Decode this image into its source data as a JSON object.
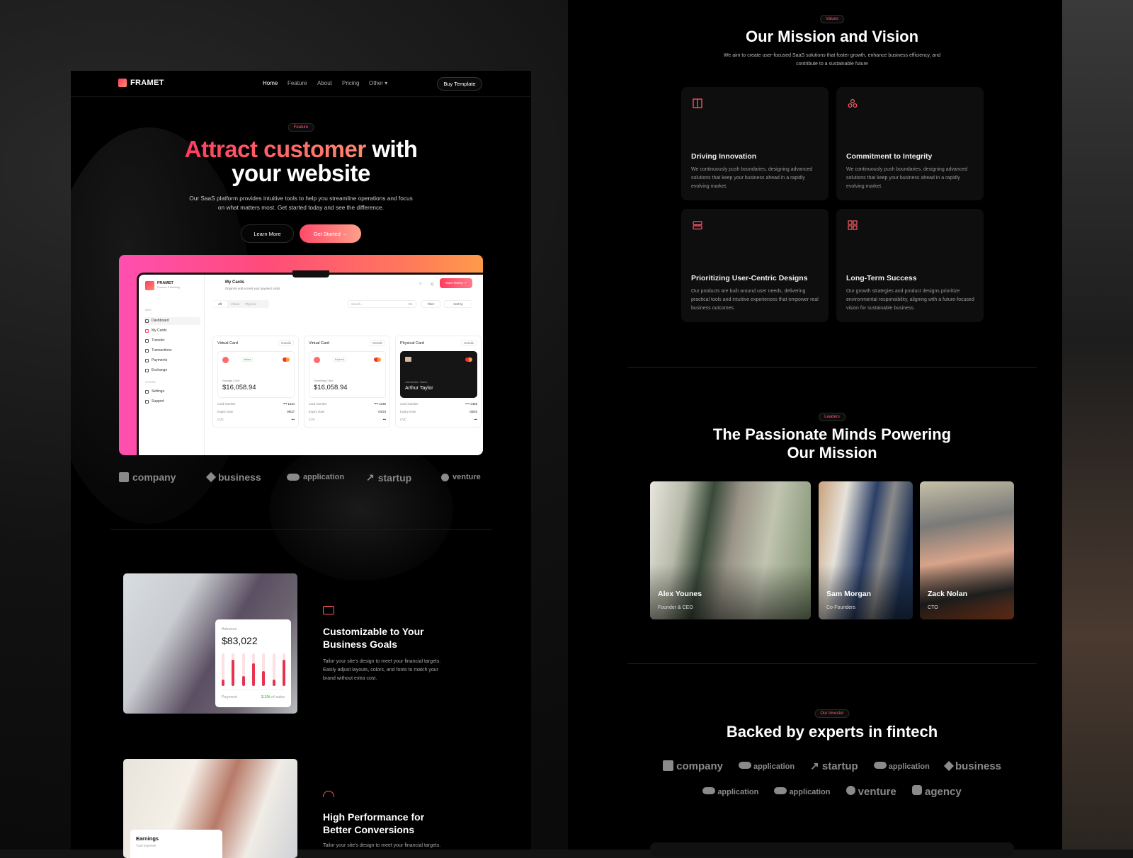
{
  "left": {
    "brand": "FRAMET",
    "nav": [
      "Home",
      "Feature",
      "About",
      "Pricing",
      "Other"
    ],
    "buy_button": "Buy Template",
    "hero": {
      "badge": "Feature",
      "title_highlight": "Attract customer",
      "title_rest1": "with",
      "title_line2": "your website",
      "subtitle_line1": "Our SaaS platform provides intuitive tools to help you streamline operations and focus",
      "subtitle_line2": "on what matters most. Get started today and see the difference.",
      "learn_more": "Learn More",
      "get_started": "Get Started →"
    },
    "dashboard": {
      "brand": "FRAMET",
      "brand_sub": "Finance & Banking",
      "section_main": "MAIN",
      "section_others": "OTHERS",
      "menu": [
        "Dashboard",
        "My Cards",
        "Transfer",
        "Transactions",
        "Payments",
        "Exchange"
      ],
      "menu_others": [
        "Settings",
        "Support"
      ],
      "page_title": "My Cards",
      "page_sub": "Organize and access your payment cards.",
      "move_money": "Move Money ↗",
      "tabs": [
        "All",
        "Virtual",
        "Physical"
      ],
      "search_placeholder": "Search...",
      "search_shortcut": "⌘1",
      "filter": "Filter",
      "sort": "Sort by",
      "cards": [
        {
          "type": "Virtual Card",
          "details": "Details",
          "status": "Active",
          "label": "Savings Card",
          "amount": "$16,058.94",
          "number": "•••• 1234",
          "expiry": "06/27",
          "cvc": "•••"
        },
        {
          "type": "Virtual Card",
          "details": "Details",
          "status": "Expired",
          "label": "Travelling Card",
          "amount": "$16,058.94",
          "number": "•••• 2345",
          "expiry": "04/23",
          "cvc": "•••"
        },
        {
          "type": "Physical Card",
          "details": "Details",
          "holder_label": "Cardholder Name",
          "holder": "Arthur Taylor",
          "number": "•••• 3456",
          "expiry": "08/20",
          "cvc": "•••"
        }
      ],
      "row_labels": {
        "number": "Card Number",
        "expiry": "Expiry Date",
        "cvc": "CVC"
      }
    },
    "logos": [
      "company",
      "business",
      "application",
      "startup",
      "venture"
    ],
    "features": [
      {
        "title_line1": "Customizable to Your",
        "title_line2": "Business Goals",
        "desc": [
          "Tailor your site's design to meet your financial targets.",
          "Easily adjust layouts, colors, and fonts to match your",
          "brand without extra cost."
        ],
        "widget": {
          "label": "Advance",
          "amount": "$83,022",
          "bars": [
            0.2,
            0.8,
            0.3,
            0.7,
            0.45,
            0.2,
            0.8
          ],
          "footer_label": "Payment",
          "pct": "2.1%",
          "pct_suffix": "of sales"
        }
      },
      {
        "title_line1": "High Performance for",
        "title_line2": "Better Conversions",
        "desc": [
          "Tailor your site's design to meet your financial targets."
        ],
        "widget": {
          "title": "Earnings",
          "sub": "Total Expense"
        }
      }
    ]
  },
  "right": {
    "values": {
      "badge": "Values",
      "title": "Our Mission and Vision",
      "subtitle_line1": "We aim to create user-focused SaaS solutions that foster growth, enhance business efficiency, and",
      "subtitle_line2": "contribute to a sustainable future",
      "cards": [
        {
          "icon": "columns-icon",
          "title": "Driving Innovation",
          "desc": "We continuously push boundaries, designing advanced solutions that keep your business ahead in a rapidly evolving market."
        },
        {
          "icon": "circles-icon",
          "title": "Commitment to Integrity",
          "desc": "We continuously push boundaries, designing advanced solutions that keep your business ahead in a rapidly evolving market."
        },
        {
          "icon": "rows-icon",
          "title": "Prioritizing User-Centric Designs",
          "desc": "Our products are built around user needs, delivering practical tools and intuitive experiences that empower real business outcomes."
        },
        {
          "icon": "grid-icon",
          "title": "Long-Term Success",
          "desc": "Our growth strategies and product designs prioritize environmental responsibility, aligning with a future-focused vision for sustainable business."
        }
      ]
    },
    "leaders": {
      "badge": "Leaders",
      "title_line1": "The Passionate Minds Powering",
      "title_line2": "Our Mission",
      "people": [
        {
          "name": "Alex Younes",
          "role": "Founder & CEO"
        },
        {
          "name": "Sam Morgan",
          "role": "Co-Founders"
        },
        {
          "name": "Zack Nolan",
          "role": "CTO"
        }
      ]
    },
    "investors": {
      "badge": "Our Investor",
      "title": "Backed by experts in fintech",
      "row1": [
        "company",
        "application",
        "startup",
        "application",
        "business"
      ],
      "row2": [
        "application",
        "application",
        "venture",
        "agency"
      ]
    }
  },
  "colors": {
    "accent": "#ff3c5f",
    "accent2": "#ff8a70",
    "bg": "#000000",
    "card": "#0e0e0e"
  }
}
